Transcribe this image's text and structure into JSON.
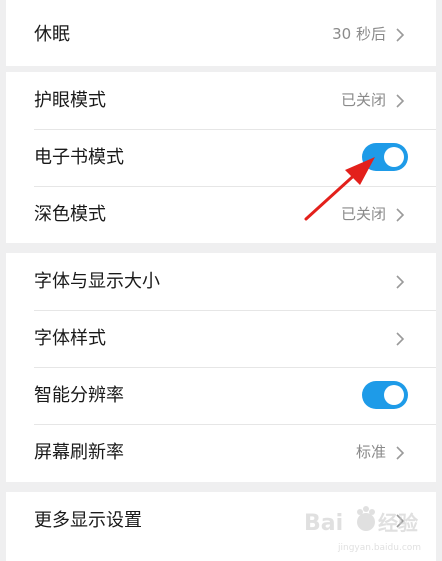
{
  "colors": {
    "background": "#efeff0",
    "card": "#ffffff",
    "label": "#1a1a1a",
    "value": "#8a8a8a",
    "toggle_on": "#1e9be8",
    "annotation_arrow": "#e3201b"
  },
  "groups": [
    {
      "rows": [
        {
          "label": "休眠",
          "value": "30 秒后",
          "control": "chevron"
        }
      ]
    },
    {
      "rows": [
        {
          "label": "护眼模式",
          "value": "已关闭",
          "control": "chevron"
        },
        {
          "label": "电子书模式",
          "value": "",
          "control": "toggle",
          "checked": true
        },
        {
          "label": "深色模式",
          "value": "已关闭",
          "control": "chevron"
        }
      ]
    },
    {
      "rows": [
        {
          "label": "字体与显示大小",
          "value": "",
          "control": "chevron"
        },
        {
          "label": "字体样式",
          "value": "",
          "control": "chevron"
        },
        {
          "label": "智能分辨率",
          "value": "",
          "control": "toggle",
          "checked": true
        },
        {
          "label": "屏幕刷新率",
          "value": "标准",
          "control": "chevron"
        }
      ]
    },
    {
      "rows": [
        {
          "label": "更多显示设置",
          "value": "",
          "control": "chevron"
        }
      ]
    }
  ],
  "watermark": {
    "brand": "Baidu",
    "suffix": "经验",
    "url": "jingyan.baidu.com"
  }
}
